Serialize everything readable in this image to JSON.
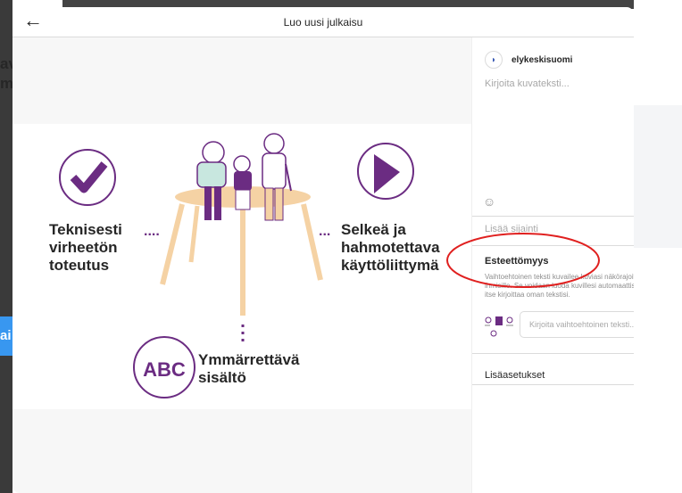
{
  "header": {
    "title": "Luo uusi julkaisu",
    "back_icon": "←"
  },
  "background": {
    "left_text_line1": "av",
    "left_text_line2": "m",
    "button_fragment": "ai"
  },
  "illustration": {
    "left_heading": [
      "Teknisesti",
      "virheetön",
      "toteutus"
    ],
    "right_heading": [
      "Selkeä ja",
      "hahmotettava",
      "käyttöliittymä"
    ],
    "bottom_heading": [
      "Ymmärrettävä",
      "sisältö"
    ],
    "abc_label": "ABC",
    "dots_left": "....",
    "dots_right": "...",
    "accent_color": "#6b2c82",
    "table_color": "#f5d2a4"
  },
  "sidebar": {
    "username": "elykeskisuomi",
    "caption_placeholder": "Kirjoita kuvateksti...",
    "emoji_icon": "☺",
    "location_placeholder": "Lisää sijainti",
    "accessibility_title": "Esteettömyys",
    "accessibility_description": "Vaihtoehtoinen teksti kuvailee kuviasi näkörajoitteisille ihmisille. Se voidaan luoda kuvillesi automaattisesti, tai voit itse kirjoittaa oman tekstisi.",
    "alt_text_placeholder": "Kirjoita vaihtoehtoinen teksti...",
    "advanced_settings": "Lisäasetukset",
    "chevron_icon": "∨"
  },
  "annotation": {
    "ellipse_color": "#e0201f"
  }
}
